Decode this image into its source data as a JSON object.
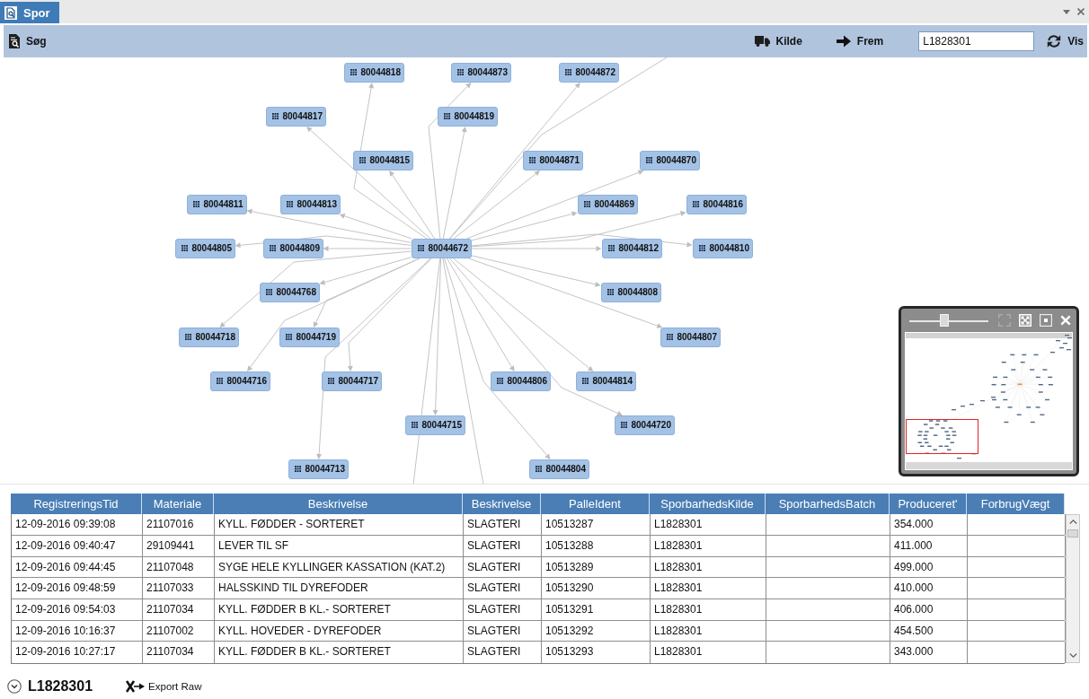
{
  "tab_strip": {
    "tabs": [
      {
        "label": "Spor",
        "selected": true
      }
    ]
  },
  "toolbar": {
    "items": [
      {
        "kind": "search",
        "label": "Søg"
      },
      {
        "kind": "source",
        "label": "Kilde"
      },
      {
        "kind": "forward",
        "label": "Frem"
      },
      {
        "kind": "field",
        "value": "L1828301"
      },
      {
        "kind": "refresh",
        "label": "Vis"
      }
    ]
  },
  "graph": {
    "root": {
      "label": "80044672",
      "children": [
        {
          "label": "80044818"
        },
        {
          "label": "80044873"
        },
        {
          "label": "80044872"
        },
        {
          "label": "80044817"
        },
        {
          "label": "80044819"
        },
        {
          "label": "80044815"
        },
        {
          "label": "80044871"
        },
        {
          "label": "80044870"
        },
        {
          "label": "80044811"
        },
        {
          "label": "80044813"
        },
        {
          "label": "80044869"
        },
        {
          "label": "80044816"
        },
        {
          "label": "80044805"
        },
        {
          "label": "80044809"
        },
        {
          "label": "80044812"
        },
        {
          "label": "80044810"
        },
        {
          "label": "80044768"
        },
        {
          "label": "80044808"
        },
        {
          "label": "80044718"
        },
        {
          "label": "80044719"
        },
        {
          "label": "80044807"
        },
        {
          "label": "80044716"
        },
        {
          "label": "80044717"
        },
        {
          "label": "80044806"
        },
        {
          "label": "80044814"
        },
        {
          "label": "80044715"
        },
        {
          "label": "80044720"
        },
        {
          "label": "80044713"
        },
        {
          "label": "80044804"
        }
      ]
    }
  },
  "overview": {
    "zoom_slider": {
      "level": 0.43
    },
    "buttons": [
      {
        "kind": "fit",
        "disabled": true
      },
      {
        "kind": "expand",
        "disabled": false
      },
      {
        "kind": "center",
        "disabled": false
      },
      {
        "kind": "close",
        "disabled": false
      }
    ]
  },
  "table": {
    "columns": [
      "RegistreringsTid",
      "Materiale",
      "Beskrivelse",
      "Beskrivelse",
      "PalleIdent",
      "SporbarhedsKilde",
      "SporbarhedsBatch",
      "Produceret'",
      "ForbrugVægt"
    ],
    "rows": [
      [
        "12-09-2016 09:39:08",
        "21107016",
        "KYLL. FØDDER - SORTERET",
        "SLAGTERI",
        "10513287",
        "L1828301",
        null,
        "354.000",
        null
      ],
      [
        "12-09-2016 09:40:47",
        "29109441",
        "LEVER TIL SF",
        "SLAGTERI",
        "10513288",
        "L1828301",
        null,
        "411.000",
        null
      ],
      [
        "12-09-2016 09:44:45",
        "21107048",
        "SYGE HELE KYLLINGER KASSATION (KAT.2)",
        "SLAGTERI",
        "10513289",
        "L1828301",
        null,
        "499.000",
        null
      ],
      [
        "12-09-2016 09:48:59",
        "21107033",
        "HALSSKIND TIL DYREFODER",
        "SLAGTERI",
        "10513290",
        "L1828301",
        null,
        "410.000",
        null
      ],
      [
        "12-09-2016 09:54:03",
        "21107034",
        "KYLL. FØDDER B KL.- SORTERET",
        "SLAGTERI",
        "10513291",
        "L1828301",
        null,
        "406.000",
        null
      ],
      [
        "12-09-2016 10:16:37",
        "21107002",
        "KYLL. HOVEDER - DYREFODER",
        "SLAGTERI",
        "10513292",
        "L1828301",
        null,
        "454.500",
        null
      ],
      [
        "12-09-2016 10:27:17",
        "21107034",
        "KYLL. FØDDER B KL.- SORTERET",
        "SLAGTERI",
        "10513293",
        "L1828301",
        null,
        "343.000",
        null
      ]
    ]
  },
  "footer": {
    "lot": "L1828301",
    "export_button": {
      "label": "Export Raw"
    }
  }
}
